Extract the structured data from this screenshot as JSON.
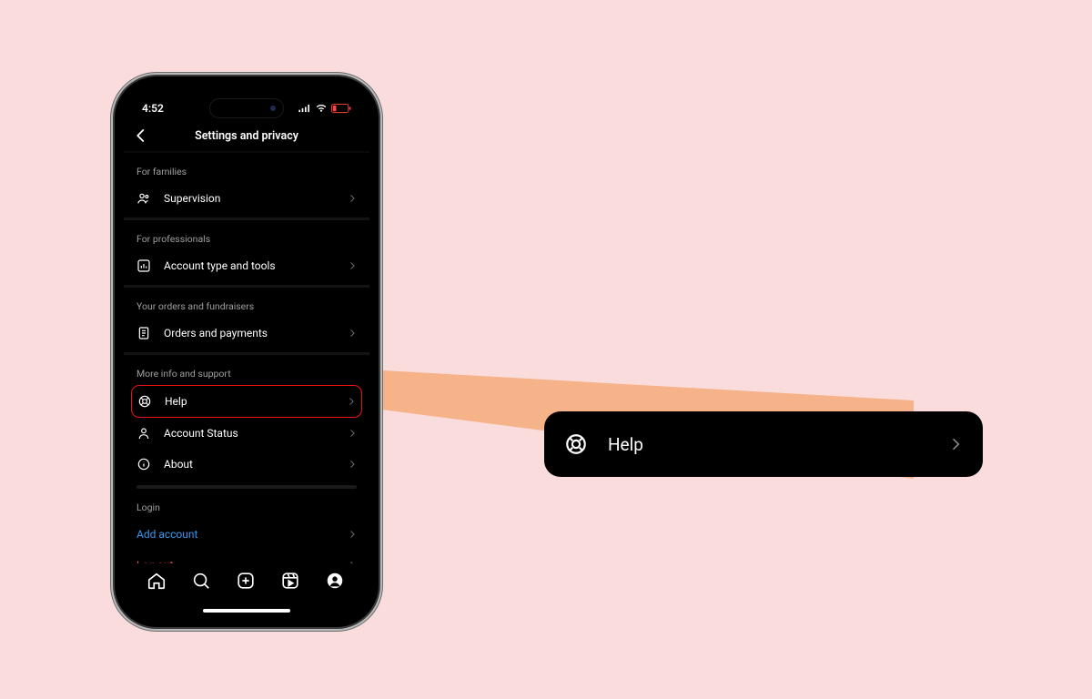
{
  "status_bar": {
    "time": "4:52"
  },
  "header": {
    "title": "Settings and privacy"
  },
  "sections": {
    "families": {
      "header": "For families",
      "item0": "Supervision"
    },
    "professionals": {
      "header": "For professionals",
      "item0": "Account type and tools"
    },
    "orders": {
      "header": "Your orders and fundraisers",
      "item0": "Orders and payments"
    },
    "support": {
      "header": "More info and support",
      "item0": "Help",
      "item1": "Account Status",
      "item2": "About"
    },
    "login": {
      "header": "Login",
      "item0": "Add account",
      "item1": "Log out"
    }
  },
  "callout": {
    "label": "Help"
  }
}
